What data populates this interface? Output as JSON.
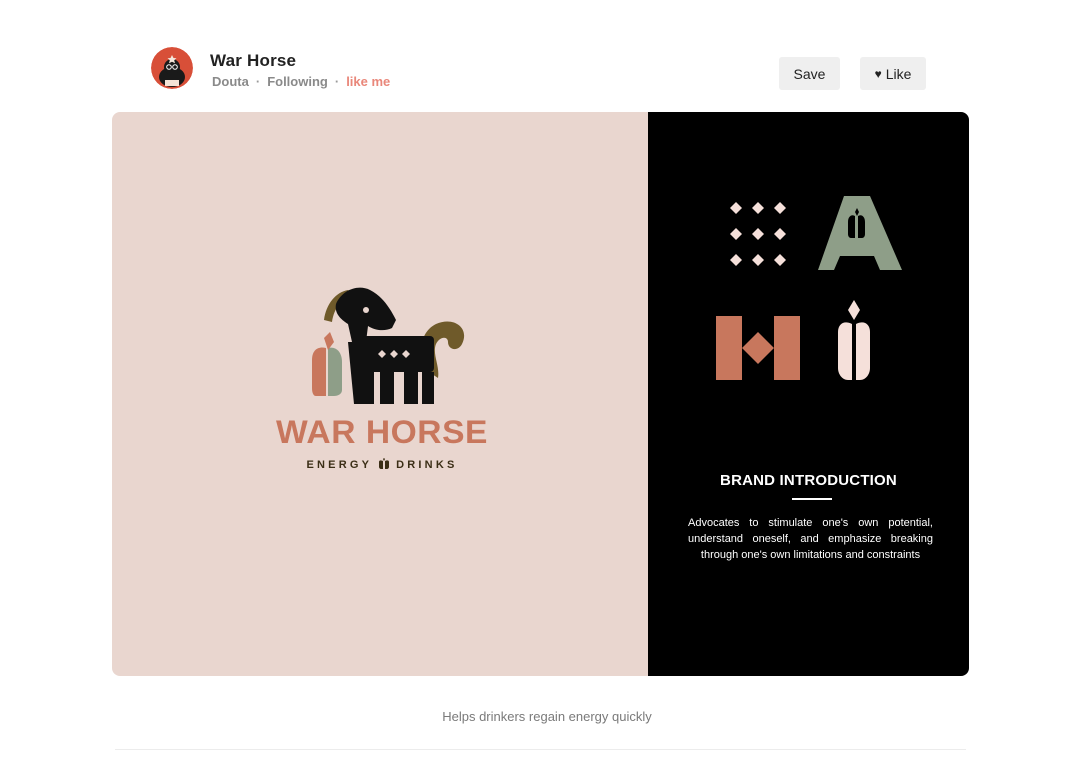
{
  "post": {
    "title": "War Horse",
    "author": "Douta",
    "follow_status": "Following",
    "like_me": "like me"
  },
  "actions": {
    "save_label": "Save",
    "like_label": "Like",
    "like_icon": "heart-icon"
  },
  "artwork": {
    "left": {
      "brand_name": "WAR HORSE",
      "tagline_left": "ENERGY",
      "tagline_right": "DRINKS",
      "background_color": "#e9d6cf",
      "accent_color": "#c8775d",
      "olive_color": "#6f5a2a",
      "sage_color": "#8e9e88"
    },
    "right": {
      "heading": "BRAND INTRODUCTION",
      "body": "Advocates to stimulate one's own potential, understand oneself, and emphasize breaking through one's own limitations and constraints",
      "background_color": "#000000"
    }
  },
  "caption": "Helps drinkers regain energy quickly"
}
